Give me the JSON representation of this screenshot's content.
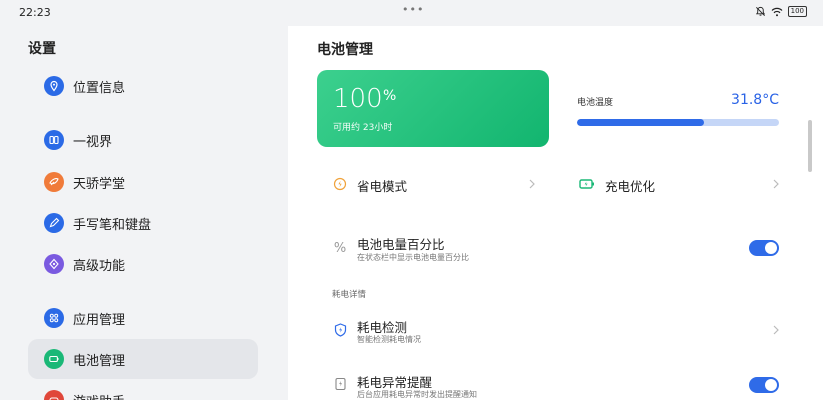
{
  "status": {
    "time": "22:23",
    "battery": "100"
  },
  "left": {
    "title": "设置",
    "items": [
      {
        "label": "位置信息",
        "color": "#2b6ae6"
      },
      {
        "label": "一视界",
        "color": "#2b6ae6"
      },
      {
        "label": "天骄学堂",
        "color": "#f07b3a"
      },
      {
        "label": "手写笔和键盘",
        "color": "#2b6ae6"
      },
      {
        "label": "高级功能",
        "color": "#7a5ae0"
      },
      {
        "label": "应用管理",
        "color": "#2b6ae6"
      },
      {
        "label": "电池管理",
        "color": "#1ab877"
      },
      {
        "label": "游戏助手",
        "color": "#e0473a"
      }
    ]
  },
  "right": {
    "title": "电池管理",
    "battery_card": {
      "percent": "100",
      "unit": "%",
      "remaining": "可用约 23小时"
    },
    "temperature": {
      "label": "电池温度",
      "value": "31.8°C",
      "level": 0.63
    },
    "power_saving": {
      "label": "省电模式"
    },
    "charge_opt": {
      "label": "充电优化"
    },
    "percent_display": {
      "label": "电池电量百分比",
      "sub": "在状态栏中显示电池电量百分比",
      "on": true
    },
    "section": "耗电详情",
    "detect": {
      "label": "耗电检测",
      "sub": "智能检测耗电情况"
    },
    "alert": {
      "label": "耗电异常提醒",
      "sub": "后台应用耗电异常时发出提醒通知",
      "on": true
    }
  },
  "colors": {
    "accent": "#2f6be8",
    "green": "#1ab877"
  }
}
